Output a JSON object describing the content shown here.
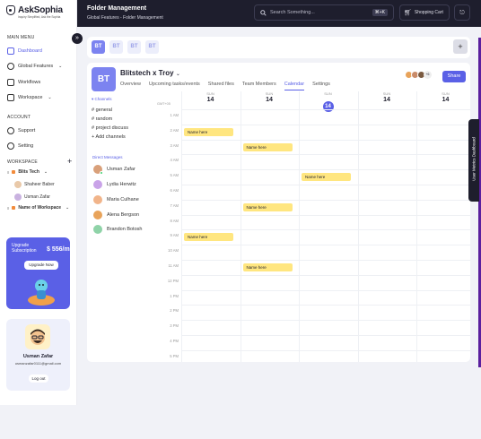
{
  "brand": {
    "name": "AskSophia",
    "tagline": "Inquiry Simplified, Ask the Sophia"
  },
  "sidebar": {
    "main_menu_title": "MAIN MENU",
    "items": [
      {
        "label": "Dashboard",
        "icon": "home-icon",
        "active": true
      },
      {
        "label": "Global Features",
        "icon": "user-icon"
      },
      {
        "label": "Workflows",
        "icon": "folder-icon"
      },
      {
        "label": "Workspace",
        "icon": "briefcase-icon"
      }
    ],
    "account_title": "ACCOUNT",
    "account_items": [
      {
        "label": "Support",
        "icon": "help-icon"
      },
      {
        "label": "Setting",
        "icon": "gear-icon"
      }
    ],
    "workspace_title": "WORKSPACE",
    "workspace_add": "+",
    "workspaces": [
      {
        "label": "Blits Tech"
      },
      {
        "label": "Shaheer Baber"
      },
      {
        "label": "Usman Zafar"
      },
      {
        "label": "Name of Workspace"
      }
    ],
    "upgrade": {
      "title": "Upgrade Subscription",
      "price": "$ 556/m",
      "button": "Upgrade Now"
    },
    "profile": {
      "name": "Usman Zafar",
      "email": "usmanzafar0111@gmail.com",
      "logout": "Log out"
    }
  },
  "header": {
    "title": "Folder Management",
    "breadcrumb": "Global Features - Folder Management",
    "search_placeholder": "Search Something...",
    "shortcut": "⌘+K",
    "cart_label": "Shopping Cart"
  },
  "tabs": [
    "BT",
    "BT",
    "BT",
    "BT"
  ],
  "add_tab": "+",
  "project": {
    "avatar": "BT",
    "name": "Blitstech x Troy",
    "tabs": [
      {
        "label": "Overview"
      },
      {
        "label": "Upcoming tasks/events"
      },
      {
        "label": "Shared files"
      },
      {
        "label": "Team Members"
      },
      {
        "label": "Calendar",
        "active": true
      },
      {
        "label": "Settings"
      }
    ],
    "more_members": "+6",
    "share_label": "Share"
  },
  "channels": {
    "header": "Channels",
    "items": [
      "general",
      "random",
      "project discuss"
    ],
    "add": "Add channels"
  },
  "direct_messages": {
    "header": "Direct Messages",
    "people": [
      {
        "name": "Usman Zafar",
        "color": "#d9a07a"
      },
      {
        "name": "Lydia Herwitz",
        "color": "#c9a3e8"
      },
      {
        "name": "Maria Culhane",
        "color": "#f1b48a"
      },
      {
        "name": "Alena Bergson",
        "color": "#e8a35a"
      },
      {
        "name": "Brandon Botosh",
        "color": "#8fd3a8"
      }
    ]
  },
  "calendar": {
    "gmt": "GMT+05",
    "days": [
      {
        "name": "SUN",
        "date": "14"
      },
      {
        "name": "SUN",
        "date": "14"
      },
      {
        "name": "SUN",
        "date": "14",
        "today": true
      },
      {
        "name": "SUN",
        "date": "14"
      },
      {
        "name": "SUN",
        "date": "14"
      }
    ],
    "times": [
      "1 AM",
      "2 AM",
      "3 AM",
      "4 AM",
      "5 AM",
      "6 AM",
      "7 AM",
      "8 AM",
      "9 AM",
      "10 AM",
      "11 AM",
      "12 PM",
      "1 PM",
      "2 PM",
      "3 PM",
      "4 PM",
      "5 PM"
    ],
    "events": [
      {
        "label": "Name here",
        "day": 0,
        "hour": 1
      },
      {
        "label": "Name here",
        "day": 1,
        "hour": 2
      },
      {
        "label": "Name here",
        "day": 2,
        "hour": 4
      },
      {
        "label": "Name here",
        "day": 1,
        "hour": 6
      },
      {
        "label": "Name here",
        "day": 0,
        "hour": 8
      },
      {
        "label": "Name here",
        "day": 1,
        "hour": 10
      }
    ]
  },
  "side_tab": "User Metrics Dashboard",
  "colors": {
    "accent": "#5a60e6",
    "dark": "#1e1e2d",
    "event": "#ffe680"
  }
}
